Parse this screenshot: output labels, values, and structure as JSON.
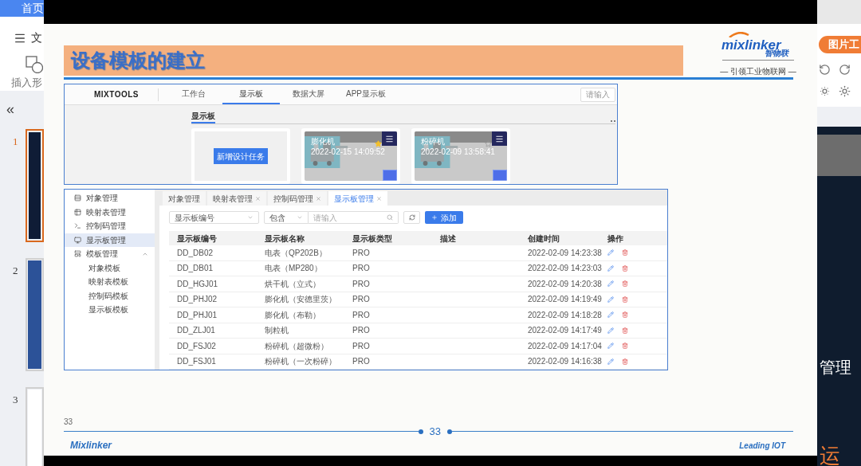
{
  "app": {
    "home_tab": "首页",
    "menu_label": "文",
    "insert_shape_label": "插入形",
    "collapse_glyph": "«",
    "slides": [
      {
        "number": "1",
        "selected": true
      },
      {
        "number": "2",
        "selected": false
      },
      {
        "number": "3",
        "selected": false
      }
    ]
  },
  "right_panel": {
    "picture_tools_button": "图片工",
    "preview_text": "管理",
    "preview_text_accent": "运"
  },
  "slide": {
    "title": "设备模板的建立",
    "logo": {
      "brand": "mixlinker",
      "brand_cn": "智物联",
      "tagline": "— 引领工业物联网 —"
    },
    "dashboard": {
      "logo": "MIXTOOLS",
      "search_placeholder": "请输入",
      "section": "显示板",
      "new_button": "新增设计任务",
      "nav": [
        {
          "label": "工作台",
          "selected": false
        },
        {
          "label": "显示板",
          "selected": true
        },
        {
          "label": "数据大屏",
          "selected": false
        },
        {
          "label": "APP显示板",
          "selected": false
        }
      ],
      "cards": [
        {
          "name": "膨化机",
          "time": "2022-02-15 14:09:52",
          "starred": true
        },
        {
          "name": "粉碎机",
          "time": "2022-02-09 13:58:41",
          "starred": false
        }
      ]
    },
    "admin": {
      "sidebar": [
        {
          "label": "对象管理",
          "selected": false
        },
        {
          "label": "映射表管理",
          "selected": false
        },
        {
          "label": "控制码管理",
          "selected": false
        },
        {
          "label": "显示板管理",
          "selected": true
        },
        {
          "label": "模板管理",
          "selected": false,
          "expanded": true,
          "children": [
            {
              "label": "对象模板"
            },
            {
              "label": "映射表模板"
            },
            {
              "label": "控制码模板"
            },
            {
              "label": "显示板模板"
            }
          ]
        }
      ],
      "tabs": [
        {
          "label": "对象管理",
          "closable": false,
          "selected": false
        },
        {
          "label": "映射表管理",
          "closable": true,
          "selected": false
        },
        {
          "label": "控制码管理",
          "closable": true,
          "selected": false
        },
        {
          "label": "显示板管理",
          "closable": true,
          "selected": true
        }
      ],
      "filter": {
        "field": "显示板编号",
        "operator": "包含",
        "placeholder": "请输入"
      },
      "add_button": "添加",
      "columns": [
        "显示板编号",
        "显示板名称",
        "显示板类型",
        "描述",
        "创建时间",
        "操作"
      ],
      "rows": [
        {
          "code": "DD_DB02",
          "name": "电表（QP202B）",
          "type": "PRO",
          "created": "2022-02-09 14:23:38"
        },
        {
          "code": "DD_DB01",
          "name": "电表（MP280）",
          "type": "PRO",
          "created": "2022-02-09 14:23:03"
        },
        {
          "code": "DD_HGJ01",
          "name": "烘干机（立式）",
          "type": "PRO",
          "created": "2022-02-09 14:20:38"
        },
        {
          "code": "DD_PHJ02",
          "name": "膨化机（安德里茨）",
          "type": "PRO",
          "created": "2022-02-09 14:19:49"
        },
        {
          "code": "DD_PHJ01",
          "name": "膨化机（布勒）",
          "type": "PRO",
          "created": "2022-02-09 14:18:28"
        },
        {
          "code": "DD_ZLJ01",
          "name": "制粒机",
          "type": "PRO",
          "created": "2022-02-09 14:17:49"
        },
        {
          "code": "DD_FSJ02",
          "name": "粉碎机（超微粉）",
          "type": "PRO",
          "created": "2022-02-09 14:17:04"
        },
        {
          "code": "DD_FSJ01",
          "name": "粉碎机（一次粉碎）",
          "type": "PRO",
          "created": "2022-02-09 14:16:38"
        }
      ]
    },
    "footer": {
      "small_page_number": "33",
      "page_number": "33",
      "brand": "Mixlinker",
      "slogan": "Leading IOT"
    }
  }
}
